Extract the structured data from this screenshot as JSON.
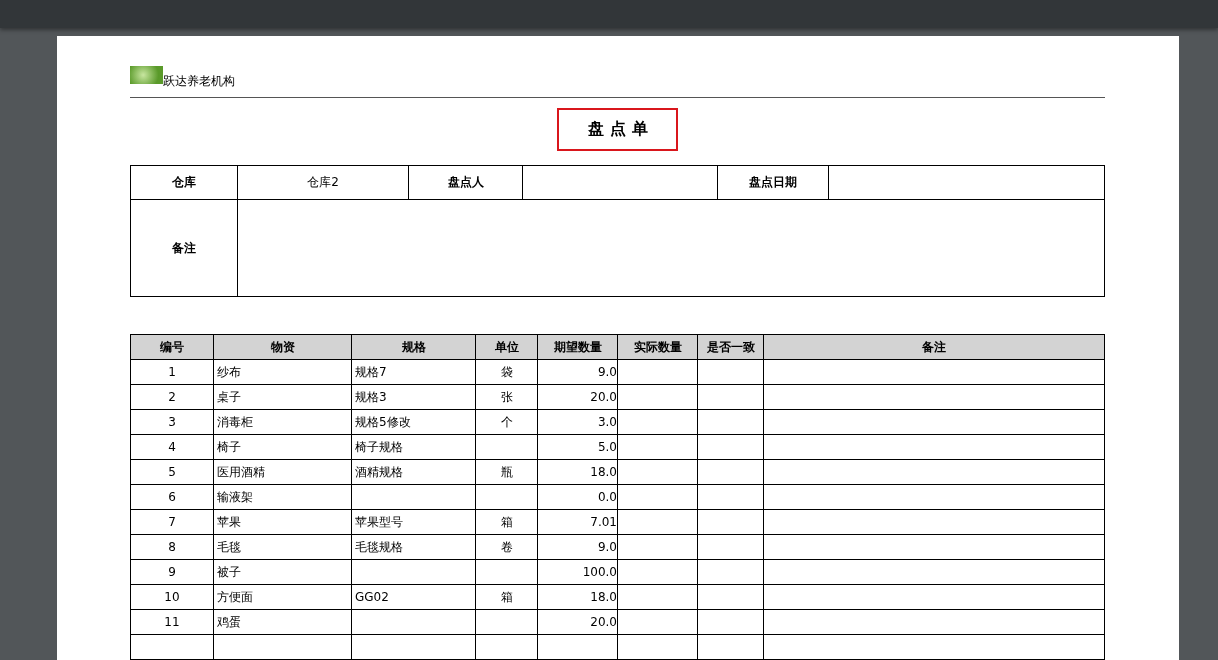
{
  "header": {
    "org_name": "跃达养老机构",
    "title": "盘点单"
  },
  "info": {
    "warehouse_label": "仓库",
    "warehouse_value": "仓库2",
    "counter_label": "盘点人",
    "date_label": "盘点日期",
    "remark_label": "备注"
  },
  "table": {
    "columns": [
      "编号",
      "物资",
      "规格",
      "单位",
      "期望数量",
      "实际数量",
      "是否一致",
      "备注"
    ],
    "rows": [
      {
        "no": "1",
        "item": "纱布",
        "spec": "规格7",
        "unit": "袋",
        "expected": "9.0"
      },
      {
        "no": "2",
        "item": "桌子",
        "spec": "规格3",
        "unit": "张",
        "expected": "20.0"
      },
      {
        "no": "3",
        "item": "消毒柜",
        "spec": "规格5修改",
        "unit": "个",
        "expected": "3.0"
      },
      {
        "no": "4",
        "item": "椅子",
        "spec": "椅子规格",
        "unit": "",
        "expected": "5.0"
      },
      {
        "no": "5",
        "item": "医用酒精",
        "spec": "酒精规格",
        "unit": "瓶",
        "expected": "18.0"
      },
      {
        "no": "6",
        "item": "输液架",
        "spec": "",
        "unit": "",
        "expected": "0.0"
      },
      {
        "no": "7",
        "item": "苹果",
        "spec": "苹果型号",
        "unit": "箱",
        "expected": "7.01"
      },
      {
        "no": "8",
        "item": "毛毯",
        "spec": "毛毯规格",
        "unit": "卷",
        "expected": "9.0"
      },
      {
        "no": "9",
        "item": "被子",
        "spec": "",
        "unit": "",
        "expected": "100.0"
      },
      {
        "no": "10",
        "item": "方便面",
        "spec": "GG02",
        "unit": "箱",
        "expected": "18.0"
      },
      {
        "no": "11",
        "item": "鸡蛋",
        "spec": "",
        "unit": "",
        "expected": "20.0"
      }
    ]
  }
}
